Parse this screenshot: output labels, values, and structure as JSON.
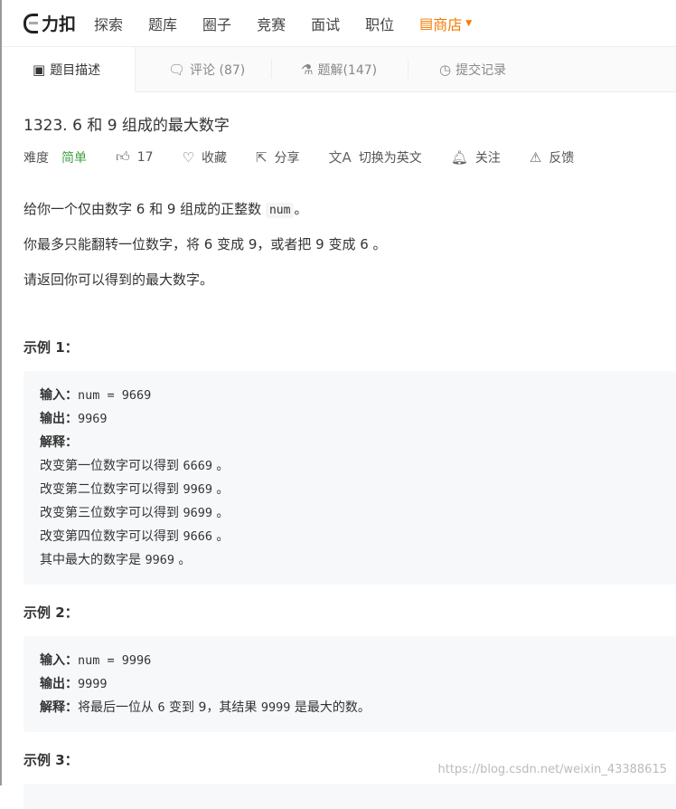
{
  "nav": {
    "logo": "力扣",
    "items": [
      "探索",
      "题库",
      "圈子",
      "竞赛",
      "面试",
      "职位"
    ],
    "shop": "商店"
  },
  "tabs": [
    "题目描述",
    "评论 (87)",
    "题解(147)",
    "提交记录"
  ],
  "problem": {
    "title": "1323. 6 和 9 组成的最大数字",
    "difficulty_label": "难度",
    "difficulty": "简单",
    "likes": "17",
    "favorite": "收藏",
    "share": "分享",
    "switch_lang": "切换为英文",
    "follow": "关注",
    "feedback": "反馈"
  },
  "desc": {
    "p1_a": "给你一个仅由数字 6 和 9 组成的正整数 ",
    "p1_code": "num",
    "p1_b": "。",
    "p2": "你最多只能翻转一位数字，将 6 变成 9，或者把 9 变成 6 。",
    "p3": "请返回你可以得到的最大数字。"
  },
  "examples": [
    {
      "title": "示例 1：",
      "input_label": "输入：",
      "input": "num = 9669",
      "output_label": "输出：",
      "output": "9969",
      "explain_label": "解释：",
      "lines": [
        [
          "改变第一位数字可以得到 ",
          "6669",
          " 。"
        ],
        [
          "改变第二位数字可以得到 ",
          "9969",
          " 。"
        ],
        [
          "改变第三位数字可以得到 ",
          "9699",
          " 。"
        ],
        [
          "改变第四位数字可以得到 ",
          "9666",
          " 。"
        ],
        [
          "其中最大的数字是 ",
          "9969",
          " 。"
        ]
      ]
    },
    {
      "title": "示例 2：",
      "input_label": "输入：",
      "input": "num = 9996",
      "output_label": "输出：",
      "output": "9999",
      "explain_label": "解释：",
      "explain_a": "将最后一位从 ",
      "explain_b": "6",
      "explain_c": " 变到 ",
      "explain_d": "9",
      "explain_e": "，其结果 ",
      "explain_f": "9999",
      "explain_g": " 是最大的数。"
    },
    {
      "title": "示例 3："
    }
  ],
  "watermark": "https://blog.csdn.net/weixin_43388615"
}
